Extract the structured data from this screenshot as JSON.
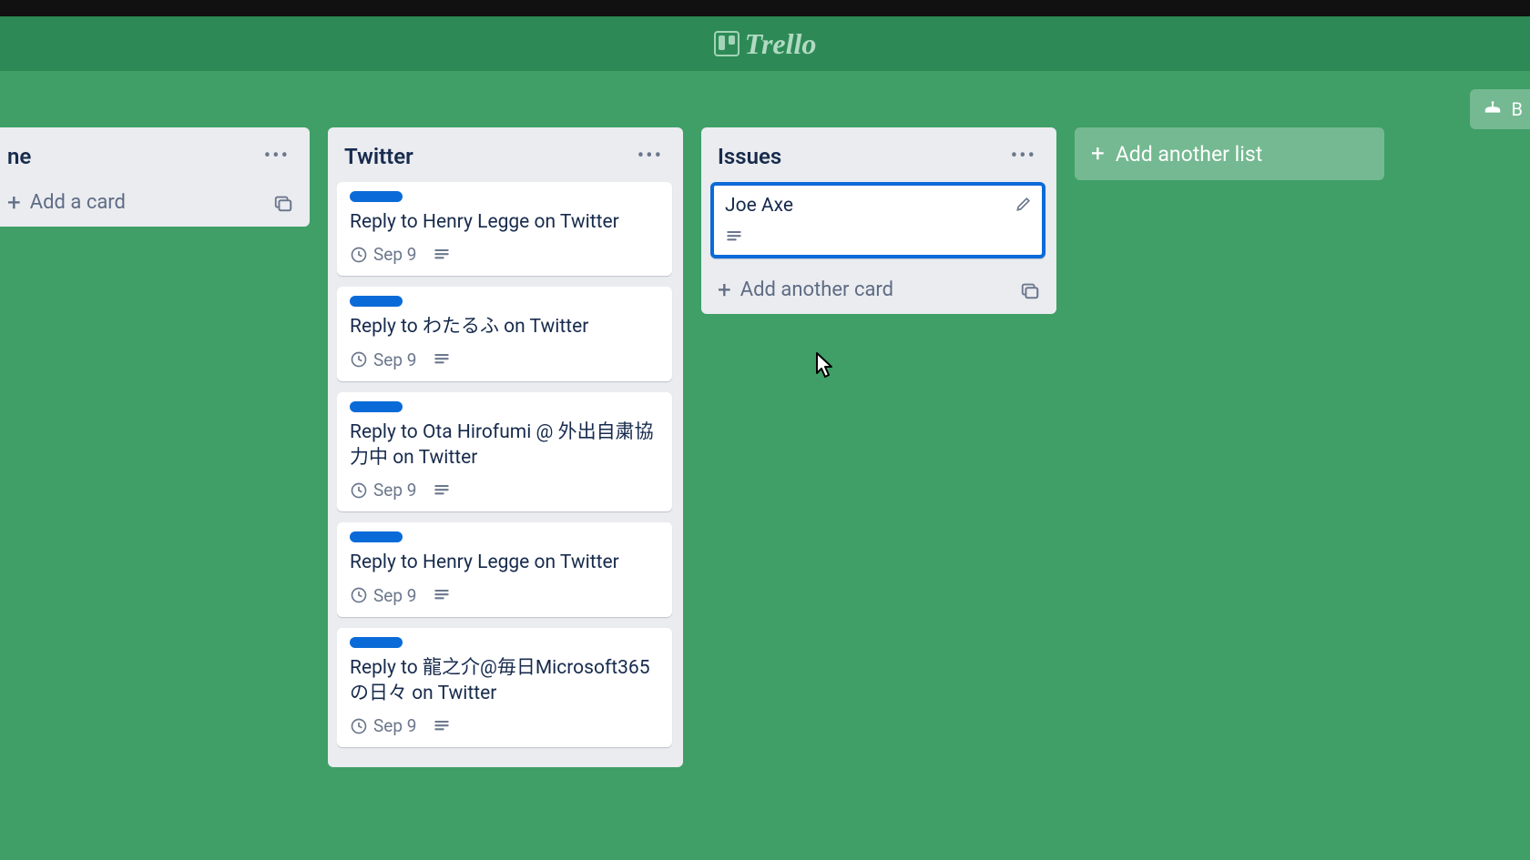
{
  "app": {
    "name": "Trello"
  },
  "header": {
    "butler_label": "B"
  },
  "lists": [
    {
      "title": "ne",
      "add_label": "Add a card",
      "cards": []
    },
    {
      "title": "Twitter",
      "add_label": "Add another card",
      "cards": [
        {
          "label_color": "#0a6bd8",
          "title": "Reply to Henry Legge on Twitter",
          "due": "Sep 9",
          "has_desc": true
        },
        {
          "label_color": "#0a6bd8",
          "title": "Reply to わたるふ on Twitter",
          "due": "Sep 9",
          "has_desc": true
        },
        {
          "label_color": "#0a6bd8",
          "title": "Reply to Ota Hirofumi @ 外出自粛協力中 on Twitter",
          "due": "Sep 9",
          "has_desc": true
        },
        {
          "label_color": "#0a6bd8",
          "title": "Reply to Henry Legge on Twitter",
          "due": "Sep 9",
          "has_desc": true
        },
        {
          "label_color": "#0a6bd8",
          "title": "Reply to 龍之介@毎日Microsoft365の日々 on Twitter",
          "due": "Sep 9",
          "has_desc": true
        }
      ]
    },
    {
      "title": "Issues",
      "add_label": "Add another card",
      "cards": [
        {
          "title": "Joe Axe",
          "has_desc": true,
          "highlighted": true
        }
      ]
    }
  ],
  "add_list_label": "Add another list"
}
